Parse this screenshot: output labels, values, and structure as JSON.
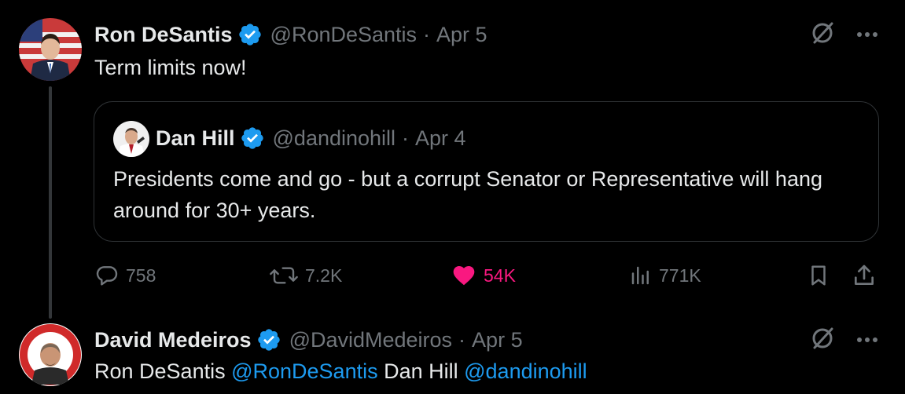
{
  "tweet1": {
    "name": "Ron DeSantis",
    "handle": "@RonDeSantis",
    "dot": "·",
    "date": "Apr 5",
    "text": "Term limits now!",
    "quote": {
      "name": "Dan Hill",
      "handle": "@dandinohill",
      "dot": "·",
      "date": "Apr 4",
      "text": "Presidents come and go - but a corrupt Senator or Representative will hang around for 30+ years."
    },
    "actions": {
      "replies": "758",
      "reposts": "7.2K",
      "likes": "54K",
      "views": "771K"
    }
  },
  "tweet2": {
    "name": "David Medeiros",
    "handle": "@DavidMedeiros",
    "dot": "·",
    "date": "Apr 5",
    "text_parts": {
      "plain1": "Ron DeSantis ",
      "mention1": "@RonDeSantis",
      "plain2": " Dan Hill ",
      "mention2": "@dandinohill"
    }
  },
  "colors": {
    "background": "#000000",
    "text": "#e7e9ea",
    "muted": "#71767b",
    "accent": "#1d9bf0",
    "like": "#f91880",
    "border": "#2f3336"
  },
  "icons": {
    "verified": "verified-badge-icon",
    "grok": "grok-slash-icon",
    "more": "more-dots-icon",
    "reply": "reply-bubble-icon",
    "repost": "repost-arrows-icon",
    "like": "heart-filled-icon",
    "views": "bar-chart-icon",
    "bookmark": "bookmark-icon",
    "share": "share-upload-icon"
  }
}
